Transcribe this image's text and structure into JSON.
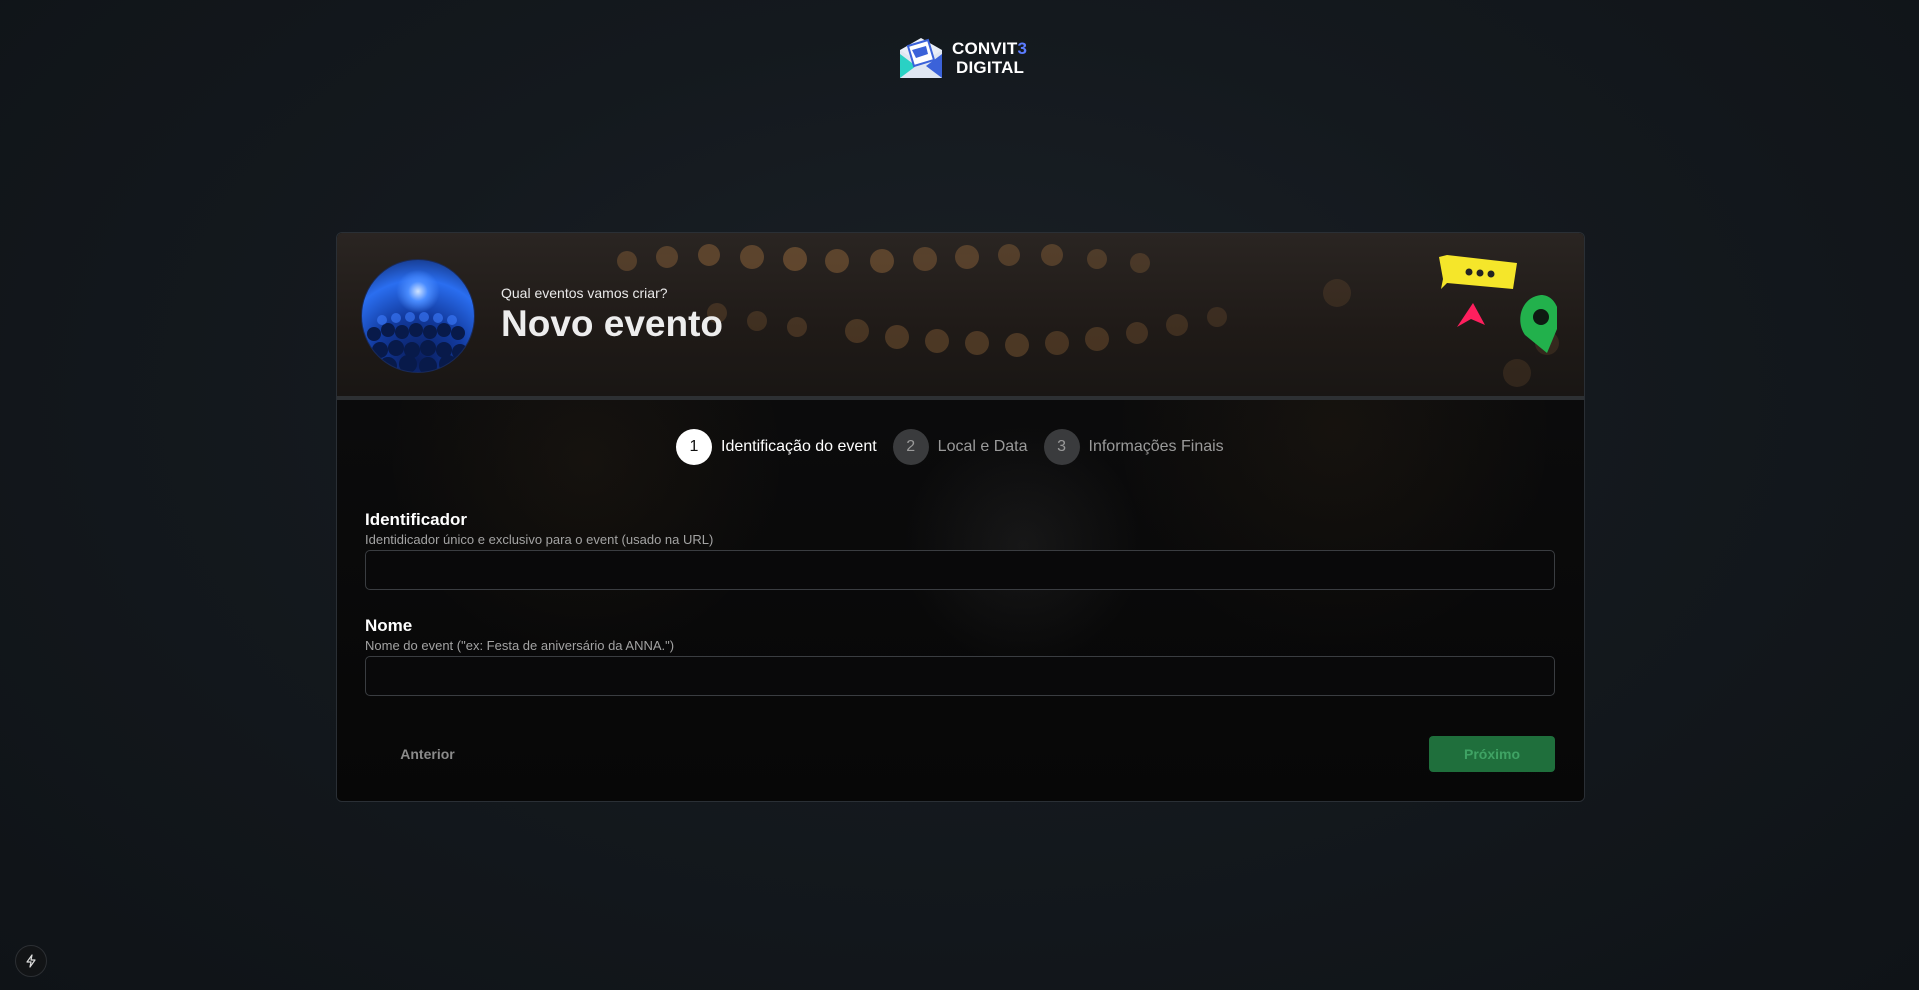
{
  "brand": {
    "line1_main": "CONVIT",
    "line1_accent": "3",
    "line2": "DIGITAL",
    "accent_color": "#5b7cff"
  },
  "header": {
    "subtitle": "Qual eventos vamos criar?",
    "title": "Novo evento",
    "avatar_icon": "crowd-concert-image",
    "decorations": [
      "chat-bubble-icon",
      "location-pin-icon",
      "cursor-arrow-icon"
    ]
  },
  "stepper": {
    "steps": [
      {
        "number": "1",
        "label": "Identificação do event",
        "active": true
      },
      {
        "number": "2",
        "label": "Local e Data",
        "active": false
      },
      {
        "number": "3",
        "label": "Informações Finais",
        "active": false
      }
    ]
  },
  "form": {
    "identificador": {
      "label": "Identificador",
      "help": "Identidicador único e exclusivo para o event (usado na URL)",
      "value": "",
      "placeholder": ""
    },
    "nome": {
      "label": "Nome",
      "help": "Nome do event (\"ex: Festa de aniversário da ANNA.\")",
      "value": "",
      "placeholder": ""
    }
  },
  "actions": {
    "prev_label": "Anterior",
    "next_label": "Próximo",
    "next_color": "#1f6f3c"
  },
  "colors": {
    "background": "#14191e",
    "card_border": "#2a2f35",
    "chat_yellow": "#f5e62a",
    "pin_green": "#22b14c",
    "cursor_pink": "#ff1f5e"
  }
}
